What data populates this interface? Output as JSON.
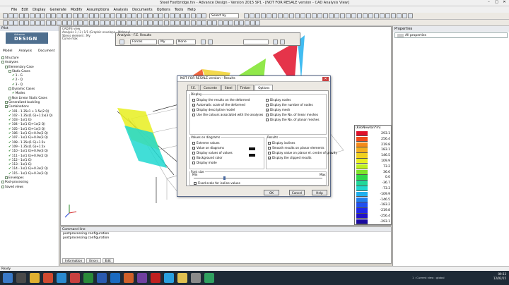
{
  "window": {
    "title": "Steel Footbridge.fsv - Advance Design - Version 2015 SP1 - [NOT FOR RESALE version - CAD Analysis View]"
  },
  "menu": [
    "File",
    "Edit",
    "Display",
    "Generate",
    "Modify",
    "Assumptions",
    "Analysis",
    "Documents",
    "Options",
    "Tools",
    "Help"
  ],
  "toolbar": {
    "select_by": "Select by"
  },
  "left_panel": {
    "title": "Pilot",
    "logo_small": "Advance",
    "logo_big": "DESIGN",
    "tabs": [
      "Model",
      "Analysis",
      "Document"
    ],
    "tree": [
      {
        "indent": 0,
        "label": "Structure",
        "type": "box"
      },
      {
        "indent": 0,
        "label": "Analyses",
        "type": "box"
      },
      {
        "indent": 1,
        "label": "Elementary Case",
        "type": "box"
      },
      {
        "indent": 2,
        "label": "Static Cases",
        "type": "box"
      },
      {
        "indent": 3,
        "label": "1 - G",
        "type": "chk"
      },
      {
        "indent": 3,
        "label": "2 - Q",
        "type": "chk"
      },
      {
        "indent": 3,
        "label": "3 - Q",
        "type": "chk"
      },
      {
        "indent": 2,
        "label": "Dynamic Cases",
        "type": "box"
      },
      {
        "indent": 3,
        "label": "Modes",
        "type": "chk"
      },
      {
        "indent": 2,
        "label": "Non Linear Static Cases",
        "type": "box"
      },
      {
        "indent": 1,
        "label": "Generalized buckling",
        "type": "box"
      },
      {
        "indent": 1,
        "label": "Combinations",
        "type": "box"
      },
      {
        "indent": 2,
        "label": "101 - 1.35x1 + 1.5x(2 Q)",
        "type": "chk"
      },
      {
        "indent": 2,
        "label": "102 - 1.35x(1 G)+1.5x(3 Q)",
        "type": "chk"
      },
      {
        "indent": 2,
        "label": "103 - 1x(1 G)",
        "type": "chk"
      },
      {
        "indent": 2,
        "label": "104 - 1x(1 G)+1x(2 Q)",
        "type": "chk"
      },
      {
        "indent": 2,
        "label": "105 - 1x(1 G)+1x(3 Q)",
        "type": "chk"
      },
      {
        "indent": 2,
        "label": "106 - 1x(1 G)+0.9x(2 Q)",
        "type": "chk"
      },
      {
        "indent": 2,
        "label": "107 - 1x(1 G)+0.9x(3 Q)",
        "type": "chk"
      },
      {
        "indent": 2,
        "label": "108 - 1.35x(1 G)+1.5x",
        "type": "chk"
      },
      {
        "indent": 2,
        "label": "109 - 1.35x(1 G)+1.5x",
        "type": "chk"
      },
      {
        "indent": 2,
        "label": "110 - 1x(1 G)+0.9x(3 Q)",
        "type": "chk"
      },
      {
        "indent": 2,
        "label": "111 - 1x(1 G)+0.9x(2 Q)",
        "type": "chk"
      },
      {
        "indent": 2,
        "label": "112 - 1x(1 G)",
        "type": "chk"
      },
      {
        "indent": 2,
        "label": "113 - 1x(1 G)",
        "type": "chk"
      },
      {
        "indent": 2,
        "label": "114 - 1x(1 G)+0.3x(2 Q)",
        "type": "chk"
      },
      {
        "indent": 2,
        "label": "115 - 1x(1 G)+0.3x(3 Q)",
        "type": "chk"
      },
      {
        "indent": 1,
        "label": "Envelopes",
        "type": "box"
      },
      {
        "indent": 0,
        "label": "Post-processing",
        "type": "box"
      },
      {
        "indent": 0,
        "label": "Saved views",
        "type": "box"
      }
    ]
  },
  "main_view": {
    "header_lines": [
      "CAD/FE view",
      "Analysis 1 / 3 / 1/1 (Graphic envelope - Mz/max)",
      "Stress element : My",
      "Curve max"
    ]
  },
  "analysis_toolbar": {
    "title": "Analysis - F.E. Results",
    "combo1": "Forces",
    "combo2": "My",
    "combo3": "None"
  },
  "properties": {
    "title": "Properties",
    "selector": "All properties"
  },
  "dialog": {
    "title": "NOT FOR RESALE version - Results",
    "tabs": [
      "F.E.",
      "Concrete",
      "Steel",
      "Timber",
      "Options"
    ],
    "display_legend": "Display",
    "display_left": [
      {
        "label": "Display the results on the deformed",
        "checked": false
      },
      {
        "label": "Automatic scale of the deformed",
        "checked": true
      },
      {
        "label": "Display descriptive model",
        "checked": true
      },
      {
        "label": "Use the colours associated with the analyses",
        "checked": false
      }
    ],
    "display_right": [
      {
        "label": "Display nodes",
        "checked": false
      },
      {
        "label": "Display the number of nodes",
        "checked": false
      },
      {
        "label": "Display mesh",
        "checked": true
      },
      {
        "label": "Display the No. of linear meshes",
        "checked": false
      },
      {
        "label": "Display the No. of planar meshes",
        "checked": false
      }
    ],
    "values_legend": "Values on diagrams",
    "values": [
      {
        "label": "Extreme values",
        "checked": false
      },
      {
        "label": "Value on diagrams",
        "checked": true
      },
      {
        "label": "Display values of values",
        "checked": false
      },
      {
        "label": "Background color",
        "checked": false
      },
      {
        "label": "Display mode",
        "checked": false
      }
    ],
    "results_legend": "Results",
    "results": [
      {
        "label": "Display isolines",
        "checked": false
      },
      {
        "label": "Smooth results on planar elements",
        "checked": false
      },
      {
        "label": "Display value on planar el. centre of gravity",
        "checked": false
      },
      {
        "label": "Display the clipped results",
        "checked": true
      }
    ],
    "font_legend": "Font size",
    "font_min": "Min",
    "font_max": "Max",
    "fixed_scale": "Fixed scale for isoline values",
    "buttons": {
      "ok": "OK",
      "cancel": "Cancel",
      "help": "Help"
    }
  },
  "color_legend": {
    "title": "(KiloNewton*m)",
    "entries": [
      {
        "value": "293.1",
        "color": "#e0102a"
      },
      {
        "value": "256.4",
        "color": "#f04a1a"
      },
      {
        "value": "219.8",
        "color": "#f58a1a"
      },
      {
        "value": "183.1",
        "color": "#f5b020"
      },
      {
        "value": "146.5",
        "color": "#f0d020"
      },
      {
        "value": "109.9",
        "color": "#e8ee20"
      },
      {
        "value": "73.2",
        "color": "#bff020"
      },
      {
        "value": "36.6",
        "color": "#7ee42a"
      },
      {
        "value": "0.0",
        "color": "#2ed84a"
      },
      {
        "value": "-36.7",
        "color": "#20d89a"
      },
      {
        "value": "-73.3",
        "color": "#20d8d0"
      },
      {
        "value": "-109.9",
        "color": "#20b0ee"
      },
      {
        "value": "-146.5",
        "color": "#2080f0"
      },
      {
        "value": "-183.2",
        "color": "#2050f0"
      },
      {
        "value": "-219.8",
        "color": "#2028e8"
      },
      {
        "value": "-256.4",
        "color": "#2012c8"
      },
      {
        "value": "-293.1",
        "color": "#1a0aa0"
      }
    ]
  },
  "command": {
    "title": "Command line",
    "lines": [
      "postprocessing configuration",
      "postprocessing configuration"
    ],
    "tabs": [
      "Information",
      "Errors",
      "Edit"
    ]
  },
  "status": {
    "left": "Ready"
  },
  "taskbar": {
    "tray_left": "1 : Current view : global",
    "clock_time": "09:33",
    "clock_date": "12/02/15",
    "icons": [
      {
        "name": "start",
        "color": "#3a7ac8"
      },
      {
        "name": "search",
        "color": "#4a4a4a"
      },
      {
        "name": "explorer",
        "color": "#e0b030"
      },
      {
        "name": "chrome",
        "color": "#d04a30"
      },
      {
        "name": "ie",
        "color": "#2a8ad0"
      },
      {
        "name": "ad",
        "color": "#c84040"
      },
      {
        "name": "excel",
        "color": "#2a8a3a"
      },
      {
        "name": "word",
        "color": "#2a5ab0"
      },
      {
        "name": "outlook",
        "color": "#1a6ac0"
      },
      {
        "name": "ppt",
        "color": "#d0602a"
      },
      {
        "name": "vs",
        "color": "#7040a0"
      },
      {
        "name": "acrobat",
        "color": "#c02020"
      },
      {
        "name": "skype",
        "color": "#2aa0e0"
      },
      {
        "name": "folder2",
        "color": "#e0c050"
      },
      {
        "name": "tool",
        "color": "#8a8a8a"
      },
      {
        "name": "chart",
        "color": "#30a060"
      }
    ]
  }
}
